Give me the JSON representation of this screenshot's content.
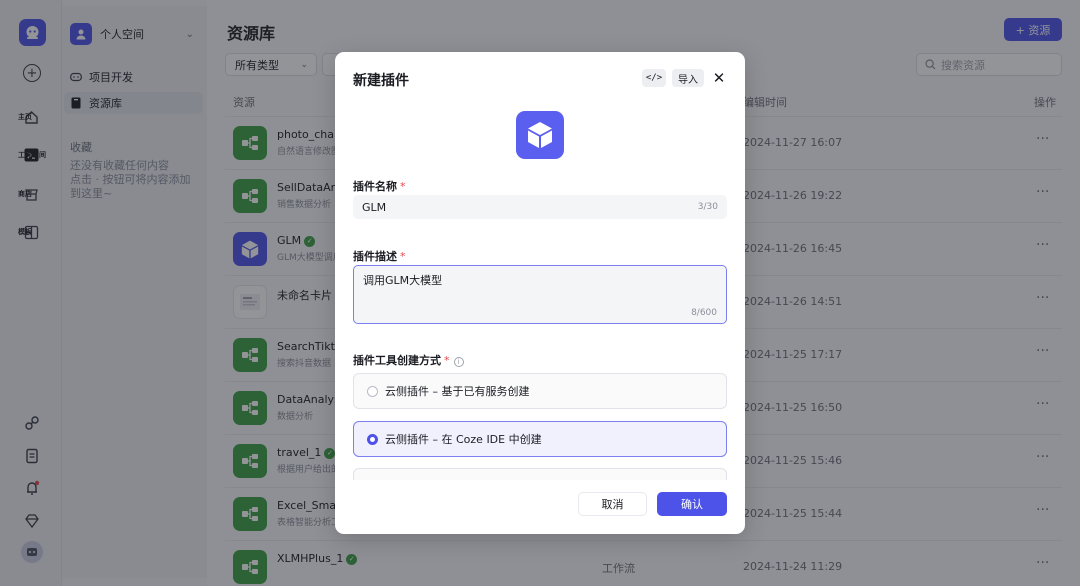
{
  "rail": {
    "items": [
      {
        "label": "主页",
        "icon": "home-icon"
      },
      {
        "label": "工作空间",
        "icon": "terminal-icon"
      },
      {
        "label": "商店",
        "icon": "store-icon"
      },
      {
        "label": "模板",
        "icon": "template-icon"
      }
    ]
  },
  "panel": {
    "workspace": "个人空间",
    "nav": [
      {
        "label": "项目开发",
        "icon": "gamepad-icon"
      },
      {
        "label": "资源库",
        "icon": "library-icon"
      }
    ],
    "favorites_title": "收藏",
    "favorites_empty": "还没有收藏任何内容",
    "favorites_hint": "点击 · 按钮可将内容添加到这里~"
  },
  "main": {
    "title": "资源库",
    "add_button": "+ 资源",
    "filter_type": "所有类型",
    "search_placeholder": "搜索资源",
    "columns": {
      "resource": "资源",
      "edit_time": "编辑时间",
      "action": "操作"
    },
    "rows": [
      {
        "name": "photo_chang",
        "desc": "自然语言修改图",
        "type": "",
        "time": "2024-11-27 16:07",
        "icon": "workflow-icon",
        "verified": false
      },
      {
        "name": "SellDataAna",
        "desc": "销售数据分析",
        "type": "",
        "time": "2024-11-26 19:22",
        "icon": "workflow-icon",
        "verified": false
      },
      {
        "name": "GLM",
        "desc": "GLM大模型调用",
        "type": "",
        "time": "2024-11-26 16:45",
        "icon": "plugin-icon",
        "verified": true
      },
      {
        "name": "未命名卡片",
        "desc": "",
        "type": "",
        "time": "2024-11-26 14:51",
        "icon": "card-icon",
        "verified": false
      },
      {
        "name": "SearchTikto",
        "desc": "搜索抖音数据",
        "type": "",
        "time": "2024-11-25 17:17",
        "icon": "workflow-icon",
        "verified": false
      },
      {
        "name": "DataAnalysi",
        "desc": "数据分析",
        "type": "",
        "time": "2024-11-25 16:50",
        "icon": "workflow-icon",
        "verified": false
      },
      {
        "name": "travel_1",
        "desc": "根据用户给出的",
        "type": "",
        "time": "2024-11-25 15:46",
        "icon": "workflow-icon",
        "verified": true
      },
      {
        "name": "Excel_Smart",
        "desc": "表格智能分析工",
        "type": "",
        "time": "2024-11-25 15:44",
        "icon": "workflow-icon",
        "verified": false
      },
      {
        "name": "XLMHPlus_1",
        "desc": "",
        "type": "工作流",
        "time": "2024-11-24 11:29",
        "icon": "workflow-icon",
        "verified": true
      }
    ],
    "more": "···"
  },
  "modal": {
    "title": "新建插件",
    "code_label": "</>",
    "import_label": "导入",
    "close_label": "✕",
    "name_label": "插件名称",
    "name_value": "GLM",
    "name_count": "3/30",
    "desc_label": "插件描述",
    "desc_value": "调用GLM大模型",
    "desc_count": "8/600",
    "method_label": "插件工具创建方式",
    "required_mark": "*",
    "options": [
      {
        "label": "云侧插件 – 基于已有服务创建",
        "selected": false
      },
      {
        "label": "云侧插件 – 在 Coze IDE 中创建",
        "selected": true
      }
    ],
    "cancel": "取消",
    "confirm": "确认"
  },
  "colors": {
    "accent": "#4d53e8",
    "workflow": "#3c9f43",
    "required": "#e5484d"
  }
}
